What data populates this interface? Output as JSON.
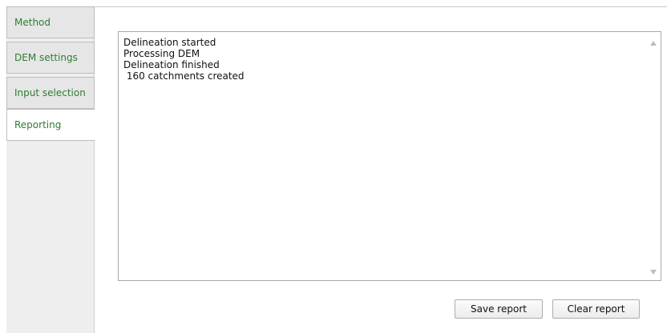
{
  "tabs": [
    {
      "label": "Method",
      "state": "inactive"
    },
    {
      "label": "DEM settings",
      "state": "inactive"
    },
    {
      "label": "Input selection",
      "state": "inactive"
    },
    {
      "label": "Reporting",
      "state": "active"
    }
  ],
  "report": {
    "lines": [
      "Delineation started",
      "Processing DEM",
      "Delineation finished",
      " 160 catchments created"
    ]
  },
  "buttons": {
    "save_label": "Save report",
    "clear_label": "Clear report"
  },
  "icons": {
    "scroll_up": "scroll-up-arrow-icon",
    "scroll_down": "scroll-down-arrow-icon"
  },
  "colors": {
    "tab_text": "#2e7d32",
    "tab_rail": "#eeeeee",
    "active_tab": "#ffffff"
  }
}
